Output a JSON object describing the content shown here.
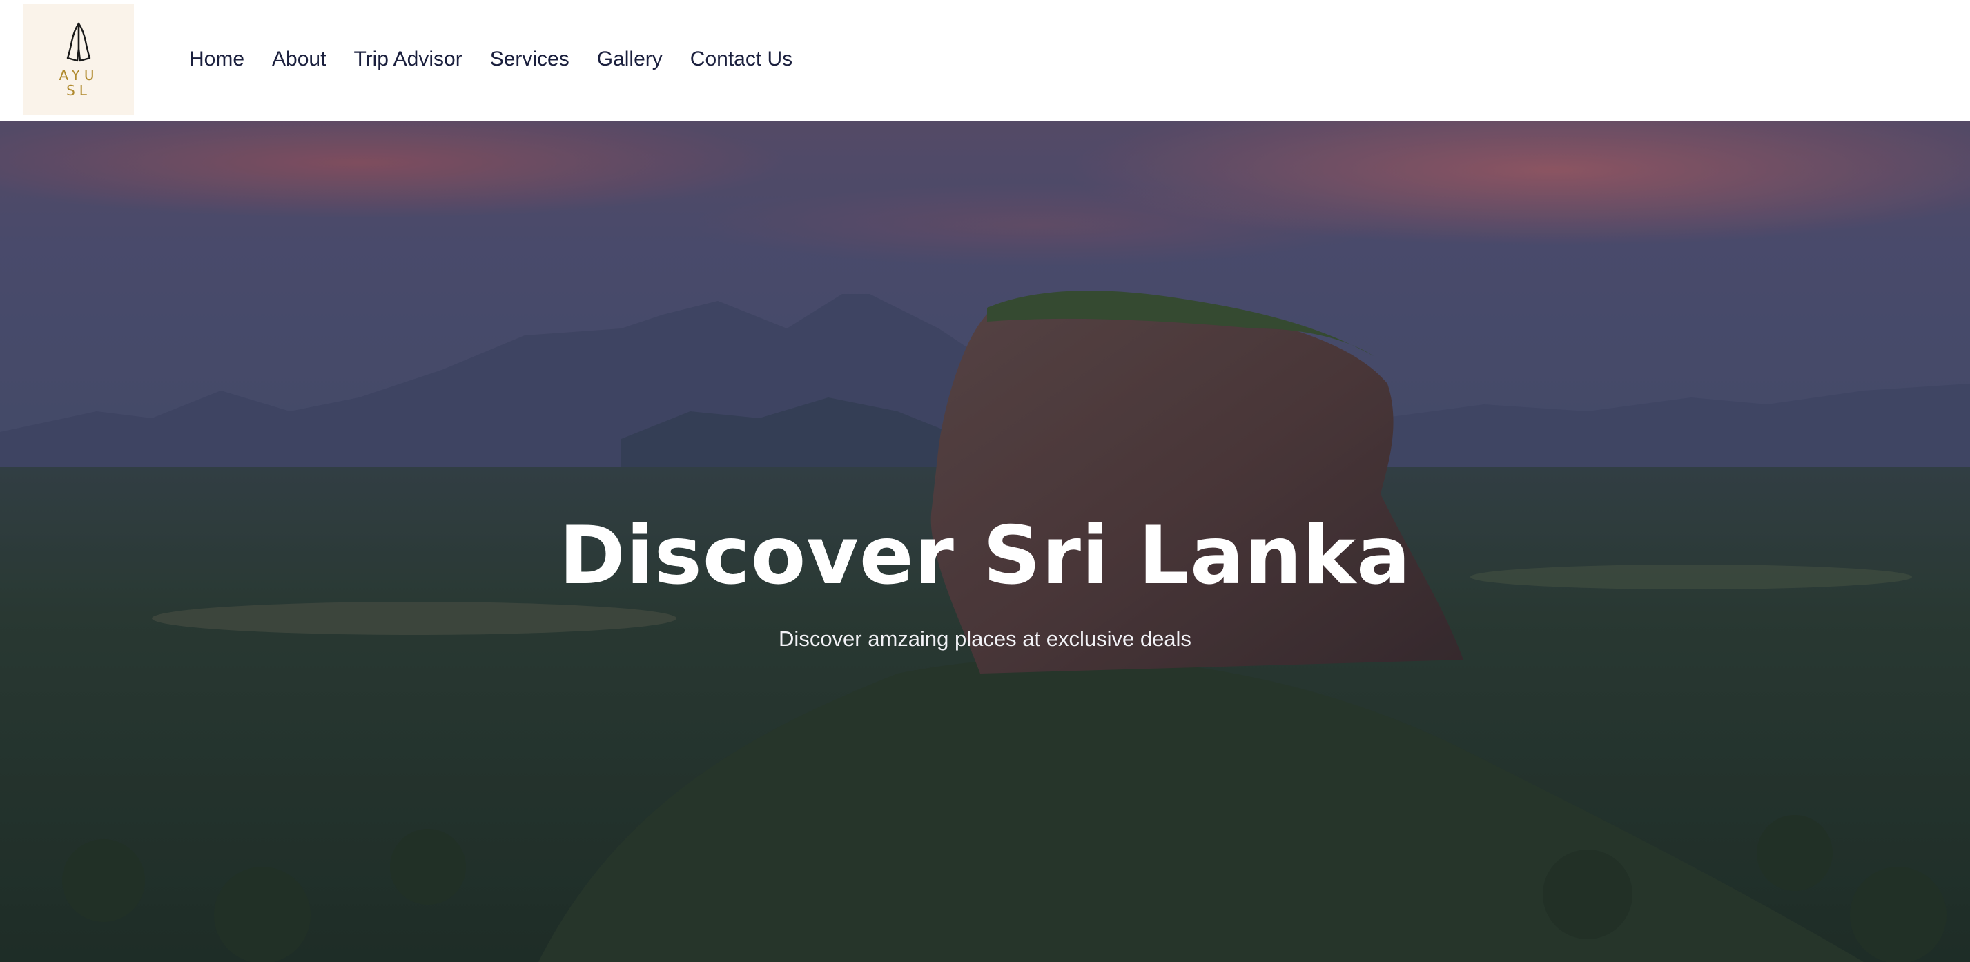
{
  "logo": {
    "icon": "praying-hands-icon",
    "line1": "AYU",
    "line2": "SL"
  },
  "nav": {
    "items": [
      {
        "label": "Home"
      },
      {
        "label": "About"
      },
      {
        "label": "Trip Advisor"
      },
      {
        "label": "Services"
      },
      {
        "label": "Gallery"
      },
      {
        "label": "Contact Us"
      }
    ]
  },
  "hero": {
    "title": "Discover Sri Lanka",
    "subtitle": "Discover amzaing places at exclusive deals"
  },
  "colors": {
    "nav_text": "#1a1f3d",
    "logo_bg": "#faf3ea",
    "logo_gold": "#b08a2e",
    "hero_text": "#ffffff"
  }
}
